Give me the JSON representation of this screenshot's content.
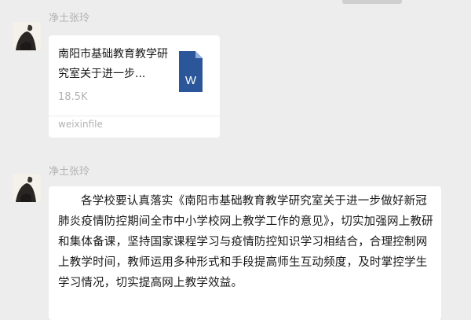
{
  "messages": [
    {
      "sender": "净土张玲",
      "file": {
        "title": "南阳市基础教育教学研究室关于进一步...",
        "size": "18.5K",
        "source": "weixinfile",
        "icon": "word-file-icon",
        "icon_letter": "W",
        "icon_color": "#2b579a"
      }
    },
    {
      "sender": "净土张玲",
      "text": "各学校要认真落实《南阳市基础教育教学研究室关于进一步做好新冠肺炎疫情防控期间全市中小学校网上教学工作的意见》，切实加强网上教研和集体备课，坚持国家课程学习与疫情防控知识学习相结合，合理控制网上教学时间，教师运用多种形式和手段提高师生互动频度，及时掌控学生学习情况，切实提高网上教学效益。"
    }
  ],
  "colors": {
    "background": "#ededed",
    "bubble": "#ffffff",
    "sender_name": "#b2b2b2"
  }
}
